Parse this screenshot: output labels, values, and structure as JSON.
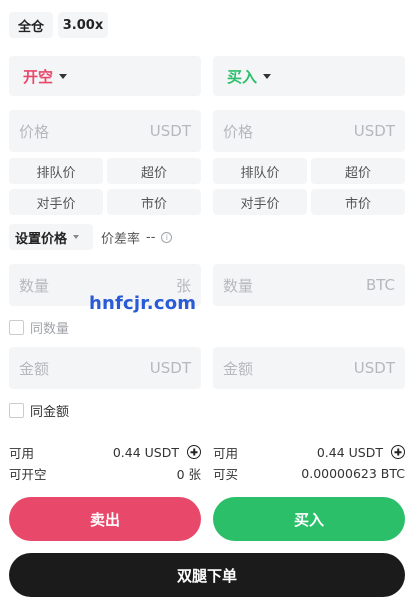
{
  "top": {
    "margin_mode": "全仓",
    "leverage": "3.00x"
  },
  "left": {
    "side_label": "开空",
    "price_placeholder": "价格",
    "price_unit": "USDT",
    "price_buttons": [
      "排队价",
      "超价",
      "对手价",
      "市价"
    ],
    "qty_placeholder": "数量",
    "qty_unit": "张",
    "same_qty_label": "同数量",
    "amount_placeholder": "金额",
    "amount_unit": "USDT",
    "same_amount_label": "同金额",
    "available_label": "可用",
    "available_value": "0.44 USDT",
    "openable_label": "可开空",
    "openable_value": "0 张",
    "action_label": "卖出"
  },
  "right": {
    "side_label": "买入",
    "price_placeholder": "价格",
    "price_unit": "USDT",
    "price_buttons": [
      "排队价",
      "超价",
      "对手价",
      "市价"
    ],
    "qty_placeholder": "数量",
    "qty_unit": "BTC",
    "amount_placeholder": "金额",
    "amount_unit": "USDT",
    "available_label": "可用",
    "available_value": "0.44 USDT",
    "buyable_label": "可买",
    "buyable_value": "0.00000623 BTC",
    "action_label": "买入"
  },
  "price_setting": {
    "label": "设置价格",
    "spread_label": "价差率",
    "spread_value": "--"
  },
  "watermark": "hnfcjr.com",
  "submit_label": "双腿下单",
  "colors": {
    "short": "#e8496a",
    "long": "#2bbf6a",
    "submit": "#1b1b1b",
    "field_bg": "#f4f5f7"
  }
}
